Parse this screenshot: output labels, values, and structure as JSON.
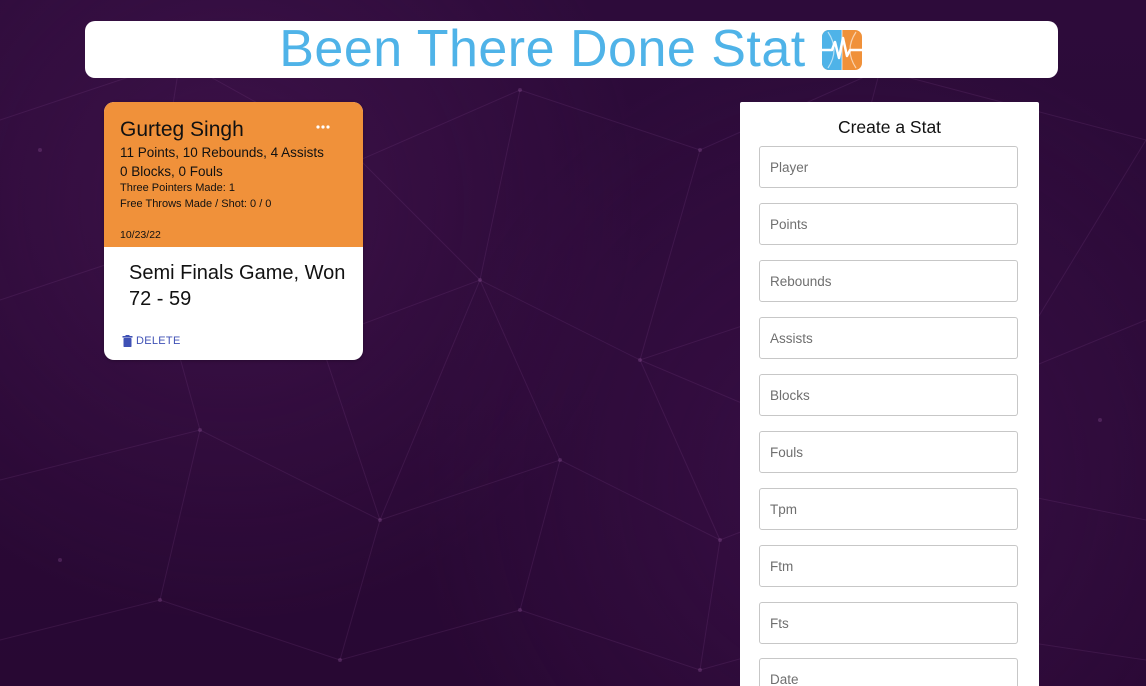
{
  "header": {
    "title": "Been There Done Stat",
    "logo_icon": "basketball-heartbeat-icon"
  },
  "stat_card": {
    "player": "Gurteg Singh",
    "menu_icon": "more-horizontal-icon",
    "line1": "11 Points, 10 Rebounds, 4 Assists",
    "line2": "0 Blocks, 0 Fouls",
    "line3": "Three Pointers Made: 1",
    "line4": "Free Throws Made / Shot: 0 / 0",
    "date": "10/23/22",
    "description": "Semi Finals Game, Won 72 - 59",
    "delete_label": "DELETE",
    "delete_icon": "trash-icon"
  },
  "form": {
    "title": "Create a Stat",
    "fields": [
      {
        "placeholder": "Player",
        "value": ""
      },
      {
        "placeholder": "Points",
        "value": ""
      },
      {
        "placeholder": "Rebounds",
        "value": ""
      },
      {
        "placeholder": "Assists",
        "value": ""
      },
      {
        "placeholder": "Blocks",
        "value": ""
      },
      {
        "placeholder": "Fouls",
        "value": ""
      },
      {
        "placeholder": "Tpm",
        "value": ""
      },
      {
        "placeholder": "Ftm",
        "value": ""
      },
      {
        "placeholder": "Fts",
        "value": ""
      },
      {
        "placeholder": "Date",
        "value": ""
      }
    ]
  },
  "colors": {
    "background": "#2a0a36",
    "title": "#4fb3e8",
    "card_header": "#f0913a",
    "delete": "#3f51b5"
  }
}
